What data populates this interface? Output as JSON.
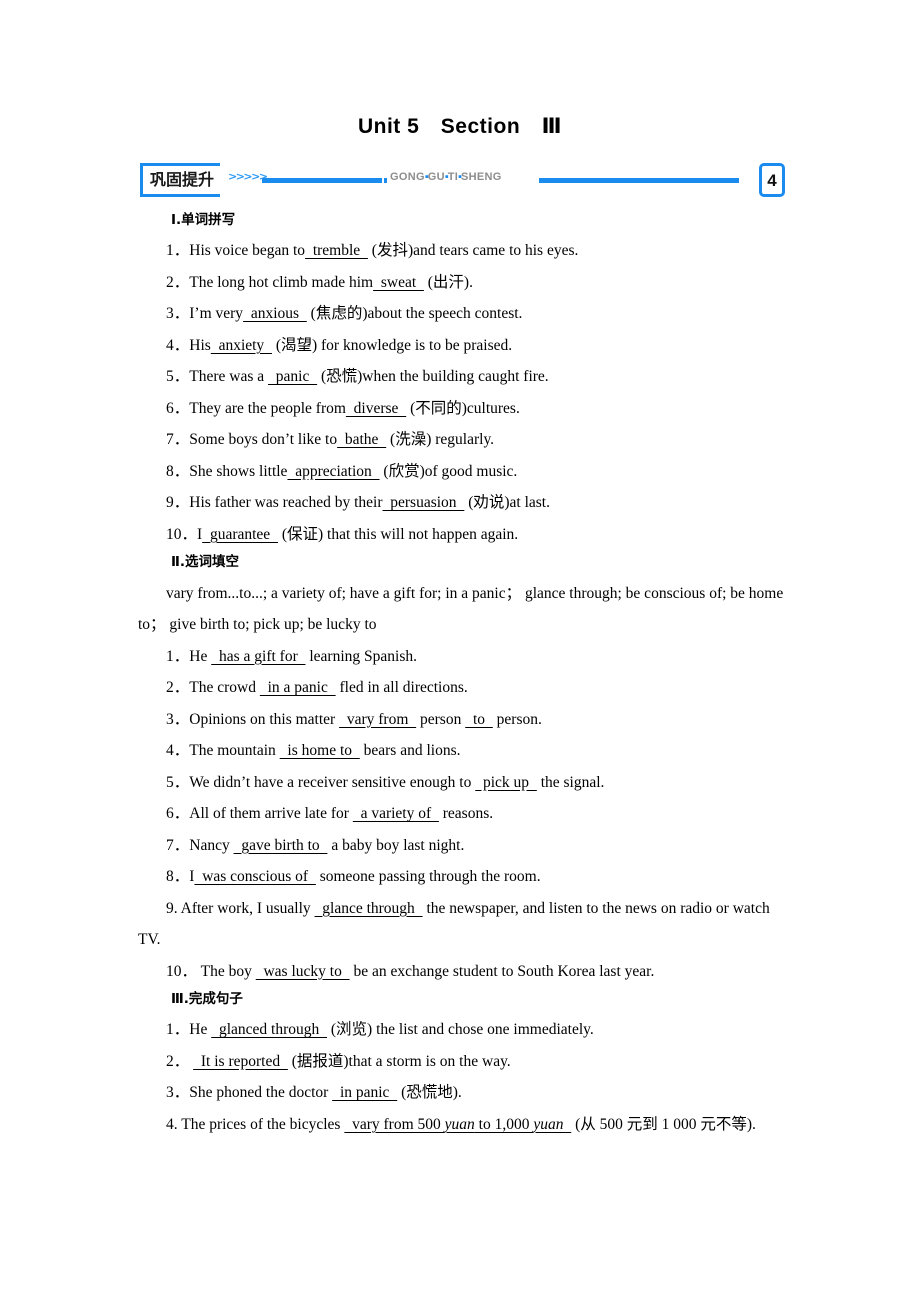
{
  "document": {
    "title": "Unit 5　Section　Ⅲ"
  },
  "banner": {
    "label": "巩固提升",
    "chevrons": ">>>>>",
    "pinyin_parts": [
      "GONG",
      "GU",
      "TI",
      "SHENG"
    ],
    "pinyin_separator": "▪",
    "number": "4",
    "accent_color": "#1a8cf0",
    "pinyin_color": "#8d8d8d"
  },
  "sections": [
    {
      "heading": "Ⅰ.单词拼写",
      "items": [
        {
          "number": "1．",
          "pre": "His voice began to",
          "blank": "  tremble  ",
          "post": " (发抖)and tears came to his eyes."
        },
        {
          "number": "2．",
          "pre": "The long hot climb made him",
          "blank": "  sweat  ",
          "post": " (出汗)."
        },
        {
          "number": "3．",
          "pre": "I’m very",
          "blank": "  anxious  ",
          "post": " (焦虑的)about the speech contest."
        },
        {
          "number": "4．",
          "pre": "His",
          "blank": "  anxiety  ",
          "post": " (渴望) for knowledge is to be praised."
        },
        {
          "number": "5．",
          "pre": "There was a ",
          "blank": "  panic  ",
          "post": " (恐慌)when the building caught fire."
        },
        {
          "number": "6．",
          "pre": "They are the people from",
          "blank": "  diverse  ",
          "post": " (不同的)cultures."
        },
        {
          "number": "7．",
          "pre": "Some boys don’t like to",
          "blank": "  bathe  ",
          "post": " (洗澡) regularly."
        },
        {
          "number": "8．",
          "pre": "She shows little",
          "blank": "  appreciation  ",
          "post": " (欣赏)of good music."
        },
        {
          "number": "9．",
          "pre": "His father was reached by their",
          "blank": "  persuasion  ",
          "post": " (劝说)at last."
        },
        {
          "number": "10．",
          "pre": "I",
          "blank": "  guarantee  ",
          "post": " (保证) that this will not happen again."
        }
      ]
    },
    {
      "heading": "Ⅱ.选词填空",
      "wordbank": "vary from...to...; a variety of; have a gift for; in a panic；  glance through; be conscious of; be home to；  give birth to; pick up; be lucky to",
      "items": [
        {
          "number": "1．",
          "pre": "He ",
          "blank": "  has a gift for  ",
          "post": "  learning Spanish."
        },
        {
          "number": "2．",
          "pre": "The crowd ",
          "blank": "  in a panic  ",
          "post": "  fled in all directions."
        },
        {
          "number": "3．",
          "pre": "Opinions on this matter ",
          "blank": "  vary from  ",
          "post": "  person ",
          "blank2": "  to  ",
          "post2": "  person."
        },
        {
          "number": "4．",
          "pre": "The mountain ",
          "blank": "  is home to  ",
          "post": "  bears and lions."
        },
        {
          "number": "5．",
          "pre": "We didn’t have a receiver sensitive enough to ",
          "blank": "  pick up  ",
          "post": "  the signal."
        },
        {
          "number": "6．",
          "pre": "All of them arrive late for ",
          "blank": "  a variety of  ",
          "post": "  reasons."
        },
        {
          "number": "7．",
          "pre": "Nancy ",
          "blank": "  gave birth to  ",
          "post": "  a baby boy last night."
        },
        {
          "number": "8．",
          "pre": "I",
          "blank": "  was conscious of  ",
          "post": "  someone passing through the room."
        },
        {
          "number": "9.",
          "pre": " After work, I usually ",
          "blank": "  glance through  ",
          "post": "  the newspaper, and listen to the news on radio or watch TV."
        },
        {
          "number": "10．",
          "pre": "  The boy ",
          "blank": "  was lucky to  ",
          "post": "  be an exchange student to South Korea last year."
        }
      ]
    },
    {
      "heading": "Ⅲ.完成句子",
      "items": [
        {
          "number": "1．",
          "pre": "He ",
          "blank": "  glanced through  ",
          "post": " (浏览) the list and chose one immediately."
        },
        {
          "number": "2．",
          "pre": " ",
          "blank": "  It is reported  ",
          "post": " (据报道)that a storm is on the way."
        },
        {
          "number": "3．",
          "pre": "She phoned the doctor ",
          "blank": "  in panic  ",
          "post": " (恐慌地)."
        },
        {
          "number": "4.",
          "pre": " The prices of the bicycles ",
          "blank_pre": "  vary from 500 ",
          "blank_ital1": "yuan",
          "blank_mid": " to 1,000 ",
          "blank_ital2": "yuan",
          "blank_post": "  ",
          "post": " (从 500 元到 1 000 元不等)."
        }
      ]
    }
  ]
}
